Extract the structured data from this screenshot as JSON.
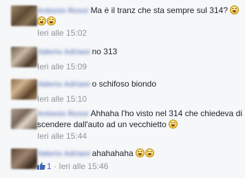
{
  "comments": [
    {
      "text": "Ma è il tranz che sta sempre sul 314?",
      "emoji_count": 3,
      "time": "Ieri alle 15:02"
    },
    {
      "text": "no 313",
      "emoji_count": 0,
      "time": "Ieri alle 15:09"
    },
    {
      "text": "o schifoso biondo",
      "emoji_count": 0,
      "time": "Ieri alle 15:10"
    },
    {
      "text": "Ahhaha l'ho visto nel 314 che chiedeva di scendere dall'auto ad un vecchietto",
      "emoji_count": 1,
      "time": "Ieri alle 15:44"
    },
    {
      "text": "ahahahaha",
      "emoji_count": 2,
      "likes": "1",
      "separator": "·",
      "time": "Ieri alle 15:46"
    }
  ],
  "icons": {
    "emoji": "laughing-tears-emoji-icon",
    "like": "thumbs-up-icon"
  },
  "colors": {
    "background": "#f6f7f9",
    "text": "#1d2129",
    "meta": "#90949c",
    "link": "#4267b2"
  }
}
